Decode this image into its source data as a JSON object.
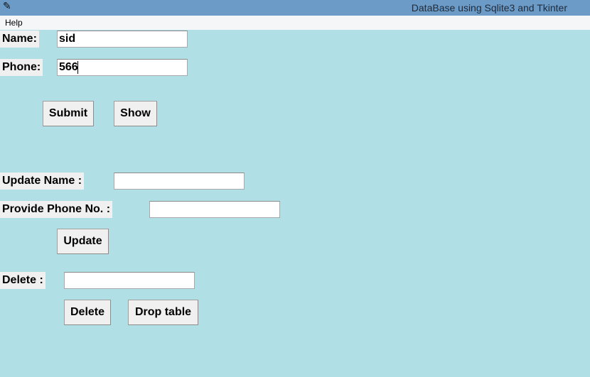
{
  "window": {
    "title": "DataBase using Sqlite3 and Tkinter",
    "icon": "feather-icon"
  },
  "menu": {
    "help_label": "Help"
  },
  "form": {
    "name_label": "Name:",
    "name_value": "sid",
    "phone_label": "Phone:",
    "phone_value": "566",
    "submit_label": "Submit",
    "show_label": "Show"
  },
  "update": {
    "name_label": "Update Name :",
    "name_value": "",
    "phone_label": "Provide Phone No. :",
    "phone_value": "",
    "button_label": "Update"
  },
  "delete": {
    "label": "Delete :",
    "value": "",
    "delete_button_label": "Delete",
    "drop_button_label": "Drop table"
  },
  "colors": {
    "background": "#b0dfe5",
    "titlebar": "#6b9bc6",
    "menubar": "#f5f6f7",
    "button": "#f0f0f0"
  }
}
